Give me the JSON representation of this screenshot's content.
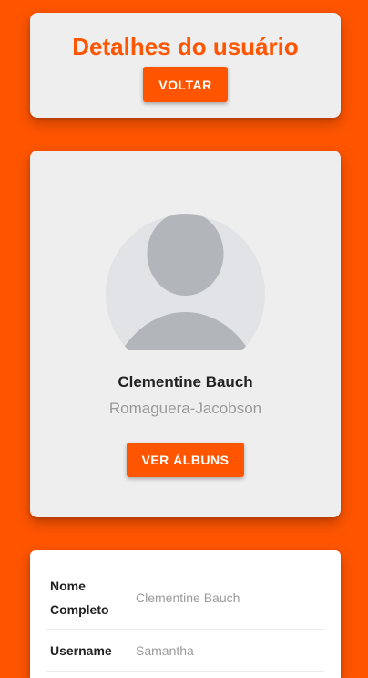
{
  "header": {
    "title": "Detalhes do usuário",
    "back_label": "VOLTAR"
  },
  "profile": {
    "avatar_icon": "default-avatar-icon",
    "name": "Clementine Bauch",
    "company": "Romaguera-Jacobson",
    "albums_label": "VER ÁLBUNS"
  },
  "details": {
    "rows": [
      {
        "label": "Nome Completo",
        "value": "Clementine Bauch"
      },
      {
        "label": "Username",
        "value": "Samantha"
      }
    ]
  },
  "colors": {
    "accent": "#ff5500",
    "card": "#eeeeee",
    "avatar_bg": "#e1e3e6",
    "avatar_fg": "#b2b6bb"
  }
}
